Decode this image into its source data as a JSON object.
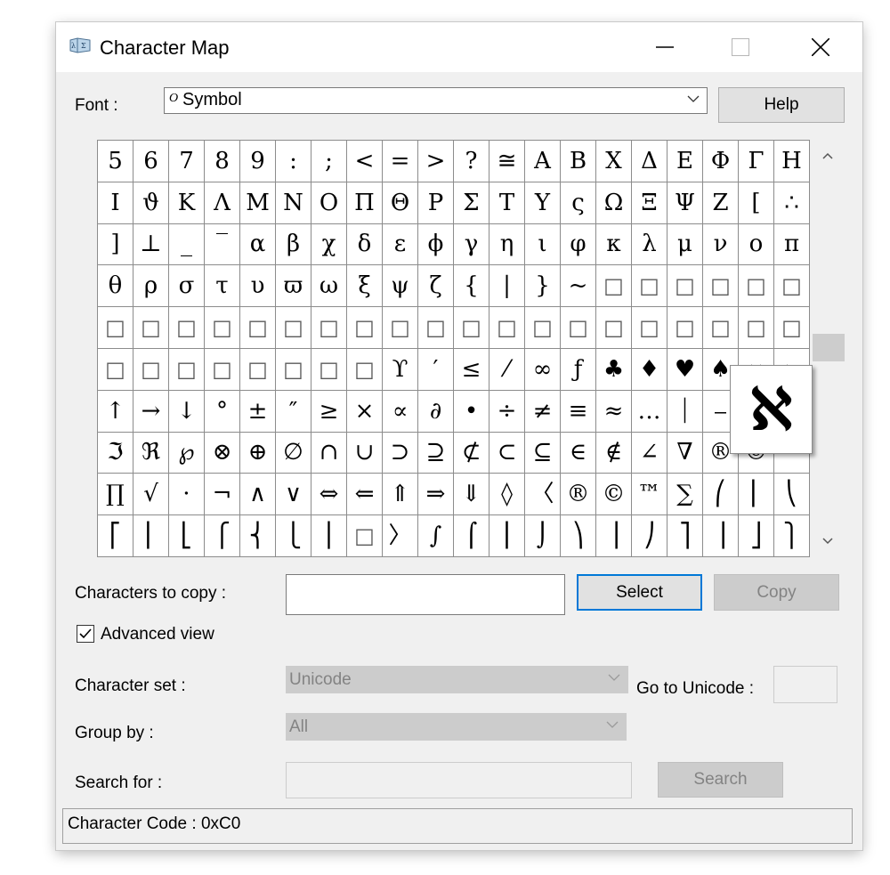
{
  "window": {
    "title": "Character Map"
  },
  "font": {
    "label": "Font :",
    "value": "Symbol",
    "type_glyph": "O",
    "help_label": "Help"
  },
  "grid": {
    "rows": [
      [
        "5",
        "6",
        "7",
        "8",
        "9",
        ":",
        ";",
        "<",
        "=",
        ">",
        "?",
        "≅",
        "Α",
        "Β",
        "Χ",
        "Δ",
        "Ε",
        "Φ",
        "Γ",
        "Η"
      ],
      [
        "Ι",
        "ϑ",
        "Κ",
        "Λ",
        "Μ",
        "Ν",
        "Ο",
        "Π",
        "Θ",
        "Ρ",
        "Σ",
        "Τ",
        "Υ",
        "ς",
        "Ω",
        "Ξ",
        "Ψ",
        "Ζ",
        "[",
        "∴"
      ],
      [
        "]",
        "⊥",
        "_",
        "‾",
        "α",
        "β",
        "χ",
        "δ",
        "ε",
        "ϕ",
        "γ",
        "η",
        "ι",
        "φ",
        "κ",
        "λ",
        "μ",
        "ν",
        "ο",
        "π"
      ],
      [
        "θ",
        "ρ",
        "σ",
        "τ",
        "υ",
        "ϖ",
        "ω",
        "ξ",
        "ψ",
        "ζ",
        "{",
        "|",
        "}",
        "~",
        "□",
        "□",
        "□",
        "□",
        "□",
        "□"
      ],
      [
        "□",
        "□",
        "□",
        "□",
        "□",
        "□",
        "□",
        "□",
        "□",
        "□",
        "□",
        "□",
        "□",
        "□",
        "□",
        "□",
        "□",
        "□",
        "□",
        "□"
      ],
      [
        "□",
        "□",
        "□",
        "□",
        "□",
        "□",
        "□",
        "□",
        "ϒ",
        "′",
        "≤",
        "⁄",
        "∞",
        "ƒ",
        "♣",
        "♦",
        "♥",
        "♠",
        "↔",
        "←"
      ],
      [
        "↑",
        "→",
        "↓",
        "°",
        "±",
        "″",
        "≥",
        "×",
        "∝",
        "∂",
        "•",
        "÷",
        "≠",
        "≡",
        "≈",
        "…",
        "⏐",
        "⎯",
        "↵",
        "ℵ"
      ],
      [
        "ℑ",
        "ℜ",
        "℘",
        "⊗",
        "⊕",
        "∅",
        "∩",
        "∪",
        "⊃",
        "⊇",
        "⊄",
        "⊂",
        "⊆",
        "∈",
        "∉",
        "∠",
        "∇",
        "®",
        "©",
        "™"
      ],
      [
        "∏",
        "√",
        "⋅",
        "¬",
        "∧",
        "∨",
        "⇔",
        "⇐",
        "⇑",
        "⇒",
        "⇓",
        "◊",
        "〈",
        "®",
        "©",
        "™",
        "∑",
        "⎛",
        "⎜",
        "⎝"
      ],
      [
        "⎡",
        "⎢",
        "⎣",
        "⎧",
        "⎨",
        "⎩",
        "⎪",
        "□",
        "〉",
        "∫",
        "⌠",
        "⎮",
        "⌡",
        "⎞",
        "⎟",
        "⎠",
        "⎤",
        "⎥",
        "⎦",
        "⎫"
      ]
    ],
    "zoomed_char": "ℵ"
  },
  "copy": {
    "label": "Characters to copy :",
    "value": "",
    "select_label": "Select",
    "copy_label": "Copy"
  },
  "advanced": {
    "label": "Advanced view",
    "checked": true
  },
  "charset": {
    "label": "Character set :",
    "value": "Unicode",
    "goto_label": "Go to Unicode :"
  },
  "groupby": {
    "label": "Group by :",
    "value": "All"
  },
  "search": {
    "label": "Search for :",
    "value": "",
    "button_label": "Search"
  },
  "status": {
    "text": "Character Code : 0xC0"
  }
}
